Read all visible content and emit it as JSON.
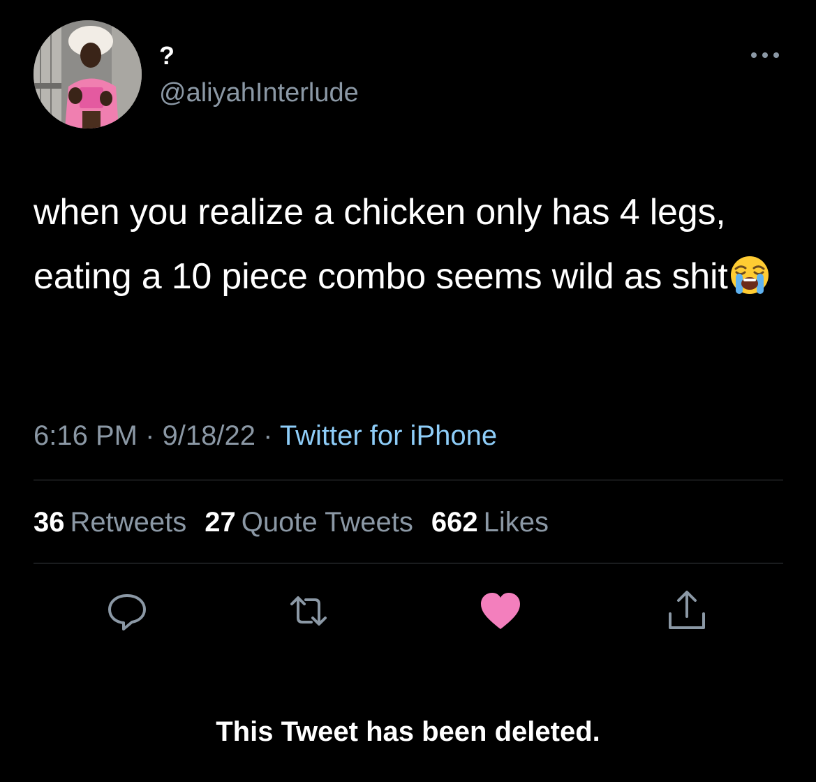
{
  "user": {
    "display_name": "?",
    "handle": "@aliyahInterlude"
  },
  "tweet": {
    "text": "when you realize a chicken only has 4 legs, eating a 10 piece combo seems wild as shit",
    "emoji": "loudly-crying-face"
  },
  "meta": {
    "time": "6:16 PM",
    "separator": "·",
    "date": "9/18/22",
    "source": "Twitter for iPhone"
  },
  "stats": [
    {
      "count": "36",
      "label": "Retweets"
    },
    {
      "count": "27",
      "label": "Quote Tweets"
    },
    {
      "count": "662",
      "label": "Likes"
    }
  ],
  "actions": {
    "reply_icon": "reply-icon",
    "retweet_icon": "retweet-icon",
    "like_icon": "heart-icon",
    "share_icon": "share-icon",
    "like_color": "#f91880",
    "icon_color": "#8b98a5"
  },
  "notice": "This Tweet has been deleted."
}
